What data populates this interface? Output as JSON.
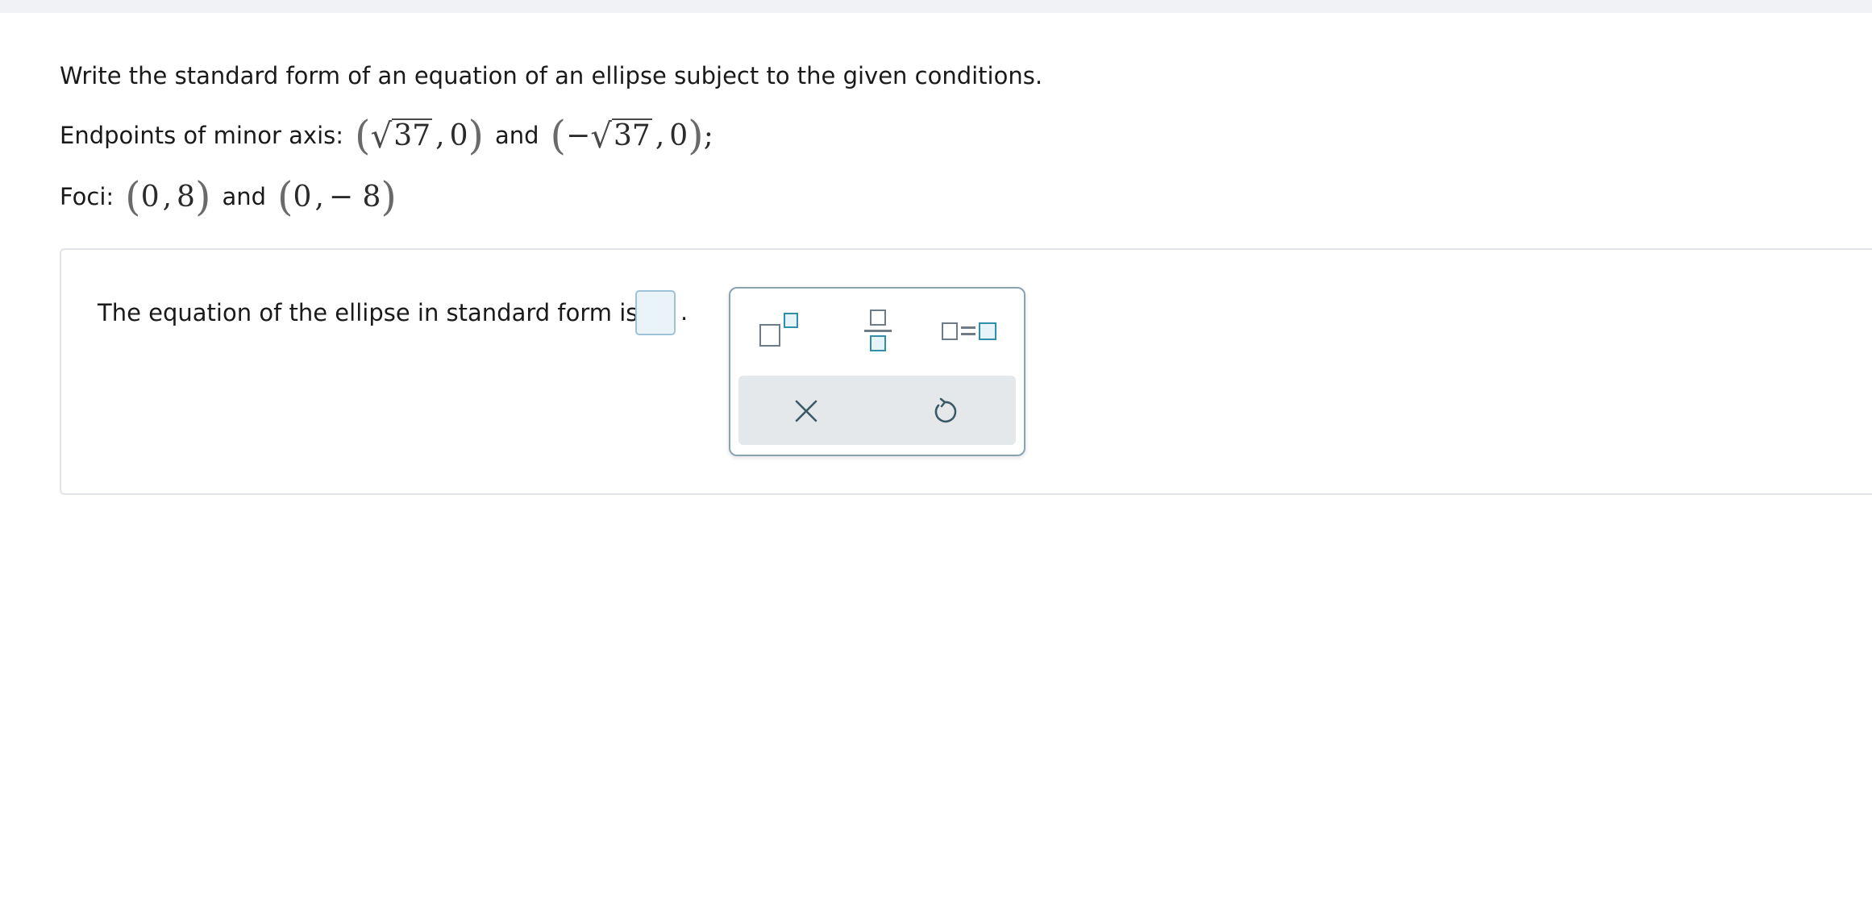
{
  "question": {
    "prompt": "Write the standard form of an equation of an ellipse subject to the given conditions.",
    "minor_axis": {
      "label": "Endpoints of minor axis:",
      "point1": {
        "x_radicand": "37",
        "y": "0"
      },
      "connector": "and",
      "point2": {
        "x_sign": "−",
        "x_radicand": "37",
        "y": "0"
      },
      "terminator": ";"
    },
    "foci": {
      "label": "Foci:",
      "point1": {
        "x": "0",
        "y": "8"
      },
      "connector": "and",
      "point2": {
        "x": "0",
        "y": "− 8"
      }
    }
  },
  "answer": {
    "sentence": "The equation of the ellipse in standard form is",
    "input_value": "",
    "period": "."
  },
  "palette": {
    "templates": [
      {
        "name": "exponent-template-icon"
      },
      {
        "name": "fraction-template-icon"
      },
      {
        "name": "equation-template-icon"
      }
    ],
    "actions": [
      {
        "name": "clear-icon"
      },
      {
        "name": "undo-icon"
      }
    ]
  },
  "colors": {
    "accent": "#2f8fa8",
    "input_fill": "#eaf4f8",
    "palette_action_bg": "#e4e8eb"
  }
}
